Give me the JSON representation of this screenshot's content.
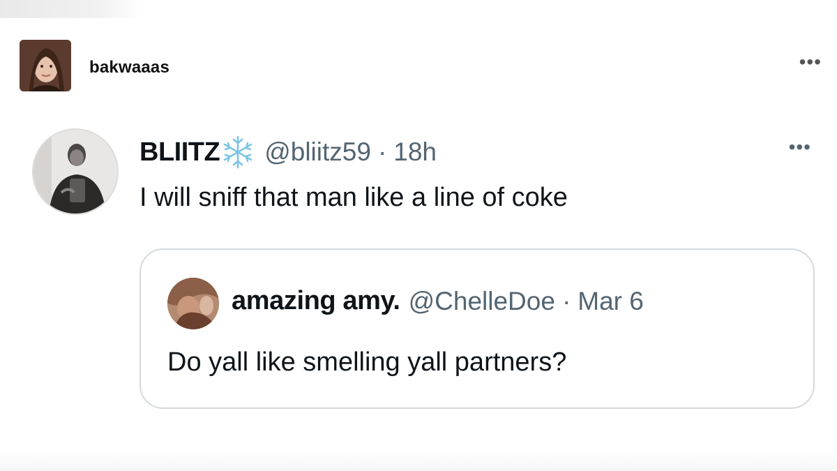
{
  "post": {
    "username": "bakwaaas",
    "more_icon": "more-horizontal-icon",
    "avatar": "user-avatar"
  },
  "tweet": {
    "name": "BLIITZ",
    "emoji": "snowflake-icon",
    "handle": "@bliitz59",
    "separator": "·",
    "time": "18h",
    "text": "I will sniff that man like a line of coke",
    "more_icon": "more-horizontal-icon",
    "accent_color": "#536471"
  },
  "quote": {
    "name": "amazing amy.",
    "handle": "@ChelleDoe",
    "separator": "·",
    "time": "Mar 6",
    "text": "Do yall like smelling yall partners?"
  }
}
